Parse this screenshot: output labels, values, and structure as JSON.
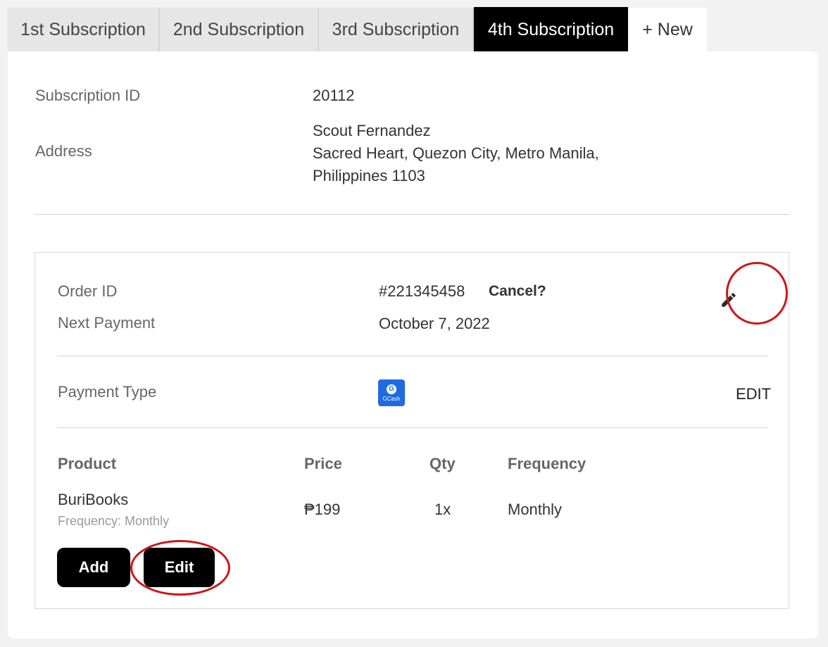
{
  "tabs": [
    {
      "label": "1st Subscription"
    },
    {
      "label": "2nd Subscription"
    },
    {
      "label": "3rd Subscription"
    },
    {
      "label": "4th Subscription",
      "active": true
    },
    {
      "label": "+ New"
    }
  ],
  "subscription": {
    "id_label": "Subscription ID",
    "id_value": "20112",
    "address_label": "Address",
    "address_lines": [
      "Scout Fernandez",
      "Sacred Heart, Quezon City, Metro Manila,",
      "Philippines 1103"
    ]
  },
  "order": {
    "order_id_label": "Order ID",
    "order_id_value": "#221345458",
    "cancel_label": "Cancel?",
    "next_payment_label": "Next Payment",
    "next_payment_value": "October 7, 2022",
    "edit_icon": "pencil-icon"
  },
  "payment": {
    "label": "Payment Type",
    "method_icon": "gcash-logo",
    "logo_text": "GCash",
    "edit_label": "EDIT"
  },
  "products": {
    "headers": {
      "product": "Product",
      "price": "Price",
      "qty": "Qty",
      "frequency": "Frequency"
    },
    "rows": [
      {
        "name": "BuriBooks",
        "subtitle": "Frequency: Monthly",
        "price": "₱199",
        "qty": "1x",
        "frequency": "Monthly"
      }
    ]
  },
  "actions": {
    "add_label": "Add",
    "edit_label": "Edit"
  },
  "colors": {
    "accent": "#000000",
    "highlight_ring": "#d0141c",
    "gcash_blue": "#1f6ae0"
  }
}
